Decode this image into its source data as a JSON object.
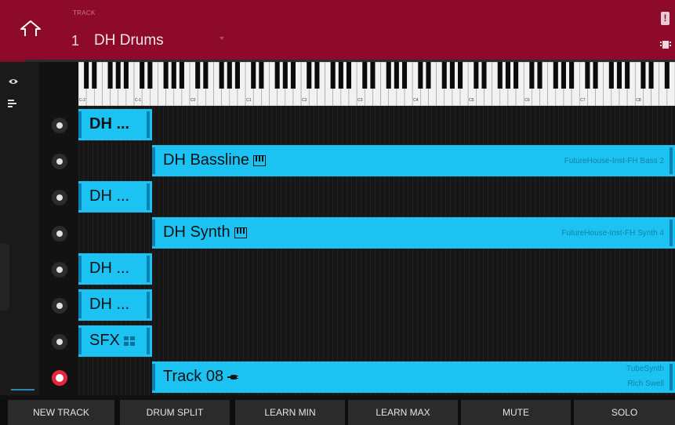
{
  "header": {
    "track_caption": "TRACK",
    "track_number": "1",
    "track_name": "DH Drums",
    "warning_label": "!"
  },
  "piano": {
    "octave_labels": [
      "C-2",
      "C-1",
      "C0",
      "C1",
      "C2",
      "C3",
      "C4",
      "C5",
      "C6",
      "C7",
      "C8"
    ]
  },
  "tracks": [
    {
      "name": "DH ...",
      "bold": true,
      "type": "drum",
      "plugin": "",
      "armed": false
    },
    {
      "name": "DH Bassline",
      "type": "keygroup",
      "plugin": "FutureHouse-Inst-FH Bass 2",
      "armed": false
    },
    {
      "name": "DH ...",
      "type": "drum",
      "plugin": "",
      "armed": false
    },
    {
      "name": "DH Synth",
      "type": "keygroup",
      "plugin": "FutureHouse-Inst-FH Synth 4",
      "armed": false
    },
    {
      "name": "DH ...",
      "type": "drum",
      "plugin": "",
      "armed": false
    },
    {
      "name": "DH ...",
      "type": "drum",
      "plugin": "",
      "armed": false
    },
    {
      "name": "SFX",
      "type": "clip",
      "plugin": "",
      "armed": false
    },
    {
      "name": "Track 08",
      "type": "plugin",
      "plugin": "TubeSynth",
      "plugin_preset": "Rich Swell",
      "armed": true
    }
  ],
  "bottom_buttons": [
    "NEW TRACK",
    "DRUM SPLIT",
    "LEARN MIN",
    "LEARN MAX",
    "MUTE",
    "SOLO"
  ],
  "colors": {
    "header_bg": "#8e0a2b",
    "clip": "#1cc2f1",
    "clip_border": "#0a80b3",
    "record": "#e6283e"
  }
}
